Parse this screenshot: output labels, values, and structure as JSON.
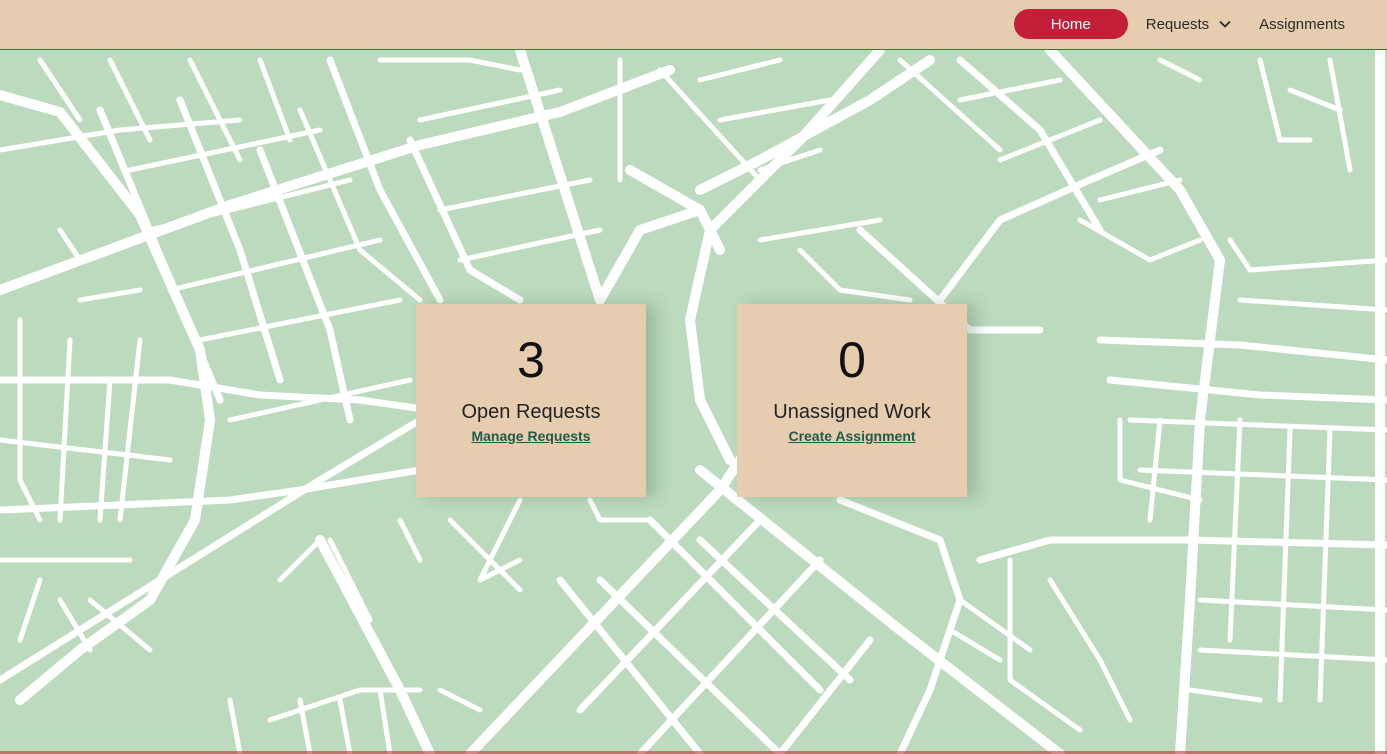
{
  "nav": {
    "home_label": "Home",
    "requests_label": "Requests",
    "assignments_label": "Assignments",
    "active_color": "#c31f38"
  },
  "cards": [
    {
      "count": "3",
      "title": "Open Requests",
      "link": "Manage Requests"
    },
    {
      "count": "0",
      "title": "Unassigned Work",
      "link": "Create Assignment"
    }
  ],
  "colors": {
    "header_bg": "#e6cdaf",
    "map_bg": "#bcdabe",
    "street": "#ffffff",
    "link": "#1f5b49",
    "accent_border": "#c0302f"
  },
  "icons": {
    "requests_dropdown": "chevron-down-icon"
  }
}
